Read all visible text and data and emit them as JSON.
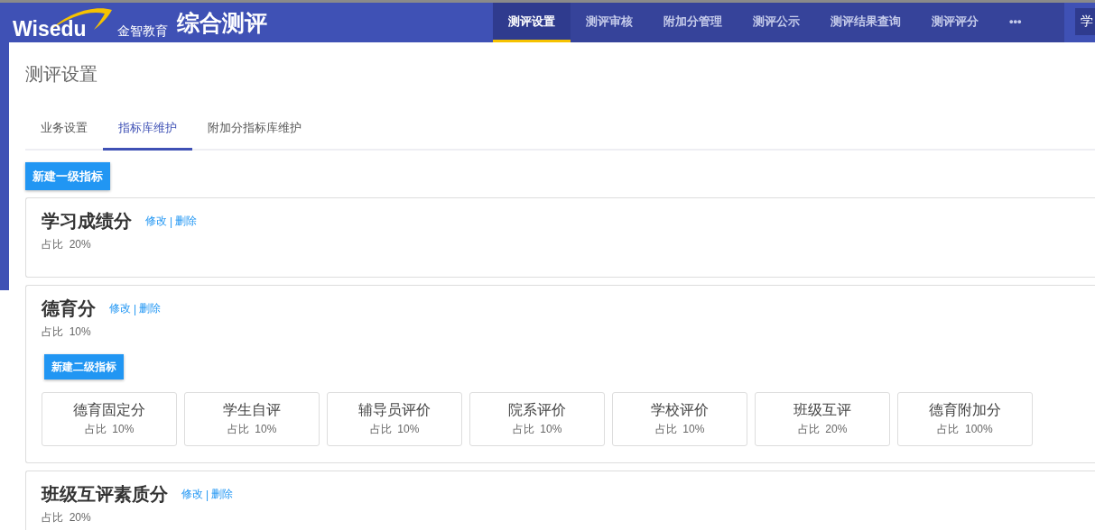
{
  "header": {
    "logo_text": "Wisedu",
    "logo_subtitle": "金智教育",
    "app_title": "综合测评",
    "nav": [
      {
        "label": "测评设置",
        "selected": true
      },
      {
        "label": "测评审核",
        "selected": false
      },
      {
        "label": "附加分管理",
        "selected": false
      },
      {
        "label": "测评公示",
        "selected": false
      },
      {
        "label": "测评结果查询",
        "selected": false
      },
      {
        "label": "测评评分",
        "selected": false
      },
      {
        "label": "•••",
        "selected": false
      }
    ],
    "user_button": "学"
  },
  "page_title": "测评设置",
  "tabs": [
    {
      "label": "业务设置",
      "selected": false
    },
    {
      "label": "指标库维护",
      "selected": true
    },
    {
      "label": "附加分指标库维护",
      "selected": false
    }
  ],
  "new_button": "新建一级指标",
  "indicators": [
    {
      "name": "学习成绩分",
      "edit": "修改",
      "separator": "|",
      "delete": "删除",
      "ratio": "占比  20%"
    },
    {
      "name": "德育分",
      "edit": "修改",
      "separator": "|",
      "delete": "删除",
      "ratio": "占比  10%",
      "sub_button": "新建二级指标",
      "children": [
        {
          "name": "德育固定分",
          "ratio": "占比  10%"
        },
        {
          "name": "学生自评",
          "ratio": "占比  10%"
        },
        {
          "name": "辅导员评价",
          "ratio": "占比  10%"
        },
        {
          "name": "院系评价",
          "ratio": "占比  10%"
        },
        {
          "name": "学校评价",
          "ratio": "占比  10%"
        },
        {
          "name": "班级互评",
          "ratio": "占比  20%"
        },
        {
          "name": "德育附加分",
          "ratio": "占比  100%"
        }
      ]
    },
    {
      "name": "班级互评素质分",
      "edit": "修改",
      "separator": "|",
      "delete": "删除",
      "ratio": "占比  20%"
    }
  ]
}
